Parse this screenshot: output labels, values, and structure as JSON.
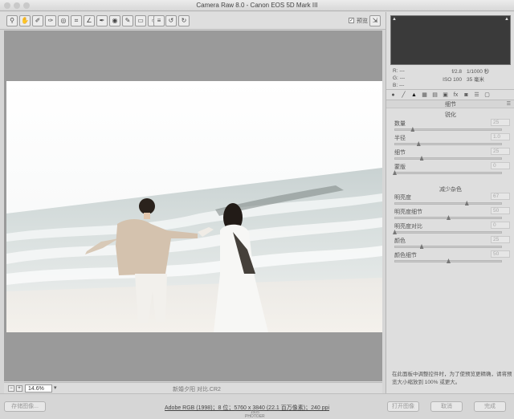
{
  "window": {
    "title": "Camera Raw 8.0 - Canon EOS 5D Mark III"
  },
  "toolbar": {
    "tools": [
      "zoom-icon",
      "hand-icon",
      "white-balance-icon",
      "color-sampler-icon",
      "target-adjust-icon",
      "crop-icon",
      "straighten-icon",
      "spot-removal-icon",
      "red-eye-icon",
      "adjustment-brush-icon",
      "graduated-filter-icon",
      "radial-filter-icon",
      "preferences-icon",
      "rotate-left-icon",
      "rotate-right-icon"
    ],
    "preview_label": "预览",
    "preview_checked": true
  },
  "canvas": {
    "zoom": "14.6%",
    "filename": "新婚夕阳 对比.CR2",
    "bg_color": "#9a9a9a"
  },
  "histogram": {
    "colors": [
      "#ff0000",
      "#00ff00",
      "#0000ff",
      "#ffff00",
      "#ff00ff",
      "#00ffff",
      "#ffffff"
    ]
  },
  "readout": {
    "r": "R:",
    "g": "G:",
    "b": "B:",
    "r_val": "---",
    "g_val": "---",
    "b_val": "---",
    "aperture": "f/2.8",
    "shutter": "1/1000 秒",
    "iso": "ISO 100",
    "focal": "35 毫米"
  },
  "panel": {
    "title": "细节",
    "tabs": [
      "basic-icon",
      "tone-curve-icon",
      "detail-icon",
      "hsl-icon",
      "split-toning-icon",
      "lens-icon",
      "fx-icon",
      "camera-calibration-icon",
      "presets-icon",
      "snapshots-icon"
    ],
    "sharpen": {
      "heading": "锐化",
      "sliders": [
        {
          "label": "数量",
          "value": "25",
          "fraction": 0.167
        },
        {
          "label": "半径",
          "value": "1.0",
          "fraction": 0.222
        },
        {
          "label": "细节",
          "value": "25",
          "fraction": 0.25
        },
        {
          "label": "蒙版",
          "value": "0",
          "fraction": 0.0
        }
      ]
    },
    "noise": {
      "heading": "减少杂色",
      "sliders": [
        {
          "label": "明亮度",
          "value": "67",
          "fraction": 0.67
        },
        {
          "label": "明亮度细节",
          "value": "50",
          "fraction": 0.5
        },
        {
          "label": "明亮度对比",
          "value": "0",
          "fraction": 0.0
        },
        {
          "label": "颜色",
          "value": "25",
          "fraction": 0.25
        },
        {
          "label": "颜色细节",
          "value": "50",
          "fraction": 0.5
        }
      ]
    },
    "hint": "在此面板中调整控件时，为了使预览更精确，请将预览大小缩放到 100% 或更大。"
  },
  "bottom": {
    "save": "存储图像...",
    "workflow": "Adobe RGB (1998)；8 位；5760 x 3840 (22.1 百万像素)；240 ppi",
    "logo_line1": "1505",
    "logo_line2": "PHOTOER",
    "open": "打开图像",
    "cancel": "取消",
    "done": "完成"
  }
}
